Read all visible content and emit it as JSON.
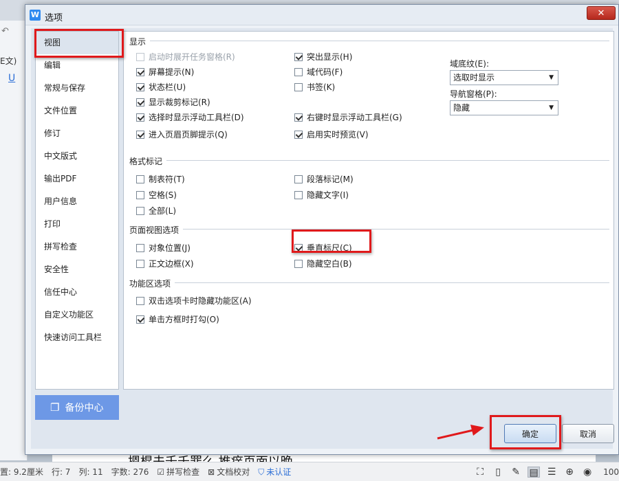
{
  "app": {
    "left_text": "E文)",
    "doc_fragment": "摁棍夫千千罪么 推痒页面以晚"
  },
  "status_bar": {
    "page_pos": "置: 9.2厘米",
    "line": "行: 7",
    "col": "列: 11",
    "word_count": "字数: 276",
    "spell_check": "拼写检查",
    "doc_proof": "文档校对",
    "auth": "未认证",
    "zoom": "100"
  },
  "dialog": {
    "title": "选项",
    "close_icon": "✕",
    "sidebar": [
      "视图",
      "编辑",
      "常规与保存",
      "文件位置",
      "修订",
      "中文版式",
      "输出PDF",
      "用户信息",
      "打印",
      "拼写检查",
      "安全性",
      "信任中心",
      "自定义功能区",
      "快速访问工具栏"
    ],
    "active_item": "视图",
    "backup_label": "备份中心",
    "sections": {
      "display": "显示",
      "format_marks": "格式标记",
      "page_view": "页面视图选项",
      "ribbon": "功能区选项"
    },
    "display_col1": [
      {
        "label": "启动时展开任务窗格(R)",
        "checked": false,
        "disabled": true
      },
      {
        "label": "屏幕提示(N)",
        "checked": true
      },
      {
        "label": "状态栏(U)",
        "checked": true
      },
      {
        "label": "显示裁剪标记(R)",
        "checked": true
      },
      {
        "label": "选择时显示浮动工具栏(D)",
        "checked": true
      },
      {
        "label": "进入页眉页脚提示(Q)",
        "checked": true
      }
    ],
    "display_col2": [
      {
        "label": "突出显示(H)",
        "checked": true
      },
      {
        "label": "域代码(F)",
        "checked": false
      },
      {
        "label": "书签(K)",
        "checked": false
      },
      {
        "label": "右键时显示浮动工具栏(G)",
        "checked": true
      },
      {
        "label": "启用实时预览(V)",
        "checked": true
      }
    ],
    "field_shading": {
      "label": "域底纹(E):",
      "value": "选取时显示"
    },
    "nav_pane": {
      "label": "导航窗格(P):",
      "value": "隐藏"
    },
    "format_marks": [
      {
        "label": "制表符(T)",
        "checked": false
      },
      {
        "label": "段落标记(M)",
        "checked": false
      },
      {
        "label": "空格(S)",
        "checked": false
      },
      {
        "label": "隐藏文字(I)",
        "checked": false
      },
      {
        "label": "全部(L)",
        "checked": false
      }
    ],
    "page_view": [
      {
        "label": "对象位置(J)",
        "checked": false
      },
      {
        "label": "垂直标尺(C)",
        "checked": true
      },
      {
        "label": "正文边框(X)",
        "checked": false
      },
      {
        "label": "隐藏空白(B)",
        "checked": false
      }
    ],
    "ribbon": [
      {
        "label": "双击选项卡时隐藏功能区(A)",
        "checked": false
      },
      {
        "label": "单击方框时打勾(O)",
        "checked": true
      }
    ],
    "ok_label": "确定",
    "cancel_label": "取消"
  },
  "colors": {
    "highlight": "#e0191b",
    "accent": "#6d98e6"
  }
}
